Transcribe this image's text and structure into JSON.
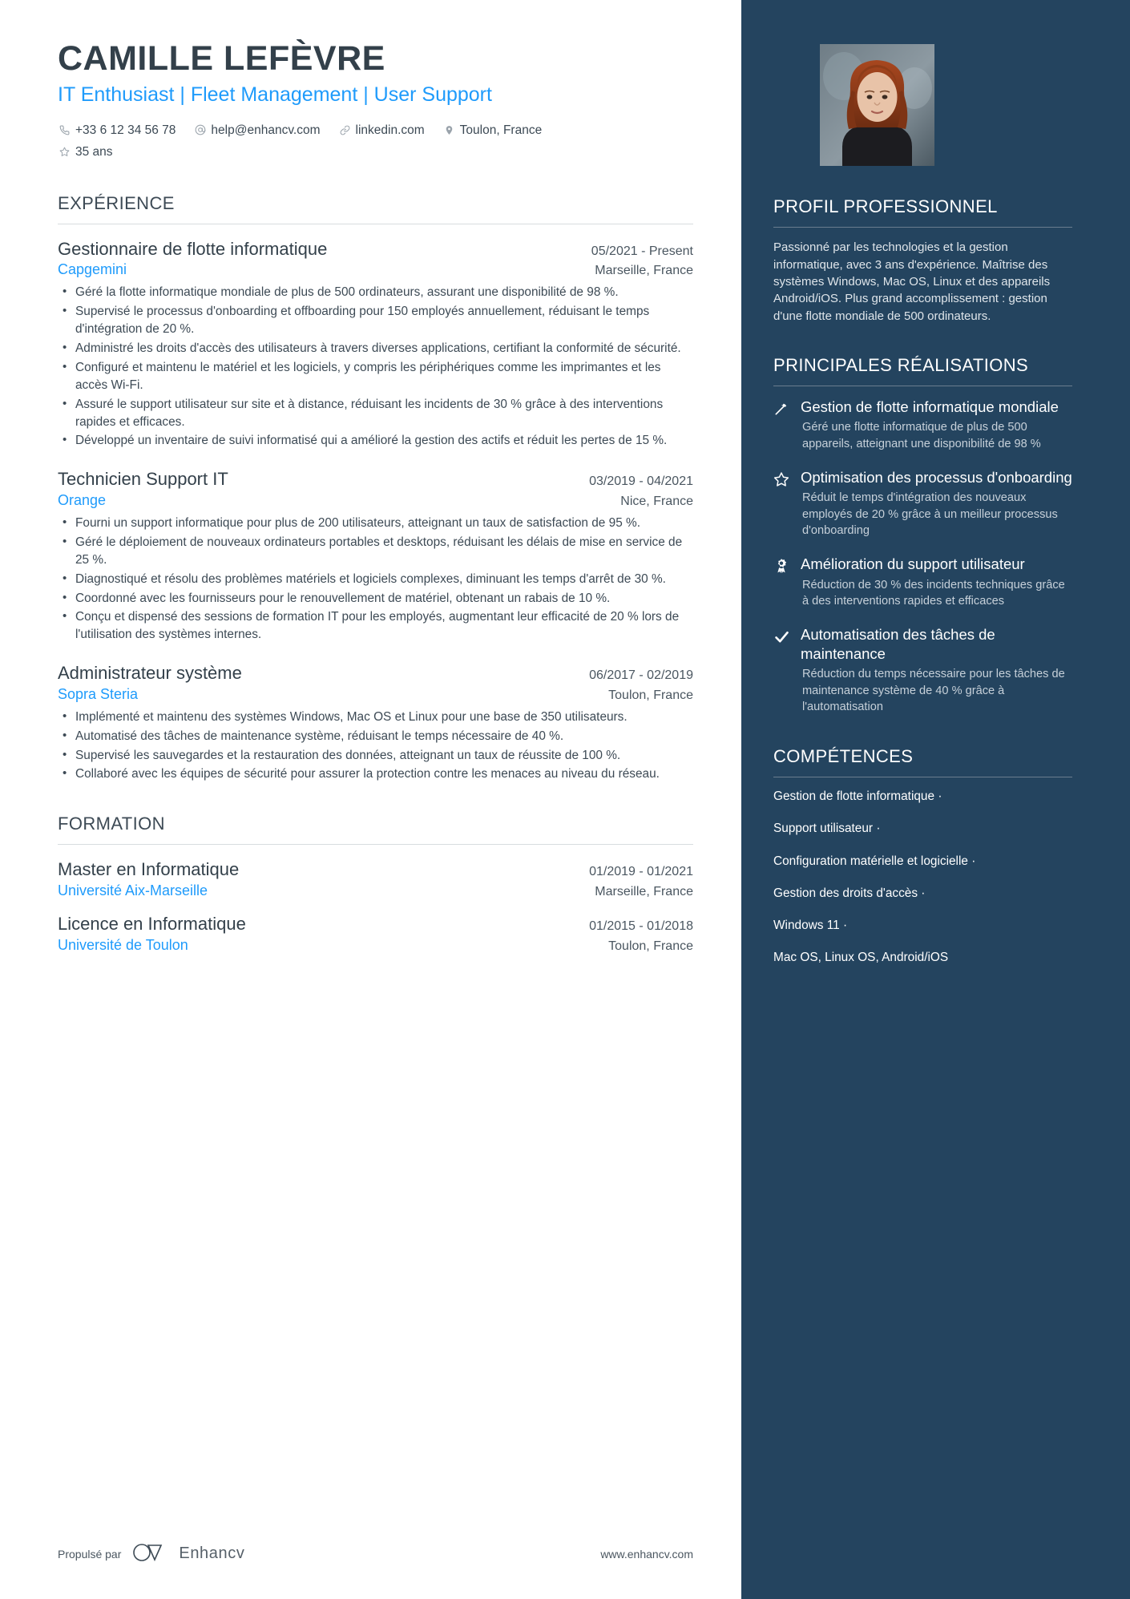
{
  "colors": {
    "accent_blue": "#1f9bfb",
    "sidebar_bg": "#24445f",
    "heading_dark": "#33404a",
    "body_text": "#3d4a55"
  },
  "header": {
    "name": "CAMILLE LEFÈVRE",
    "headline": "IT Enthusiast | Fleet Management | User Support",
    "contacts": [
      {
        "icon": "phone-icon",
        "text": "+33 6 12 34 56 78"
      },
      {
        "icon": "email-icon",
        "text": "help@enhancv.com"
      },
      {
        "icon": "link-icon",
        "text": "linkedin.com"
      },
      {
        "icon": "location-pin-icon",
        "text": "Toulon, France"
      }
    ],
    "contacts_second_row": [
      {
        "icon": "star-icon",
        "text": "35 ans"
      }
    ],
    "photo_alt": "portrait-photo"
  },
  "experience": {
    "title": "EXPÉRIENCE",
    "entries": [
      {
        "role": "Gestionnaire de flotte informatique",
        "date": "05/2021 - Present",
        "company": "Capgemini",
        "location": "Marseille, France",
        "bullets": [
          "Géré la flotte informatique mondiale de plus de 500 ordinateurs, assurant une disponibilité de 98 %.",
          "Supervisé le processus d'onboarding et offboarding pour 150 employés annuellement, réduisant le temps d'intégration de 20 %.",
          "Administré les droits d'accès des utilisateurs à travers diverses applications, certifiant la conformité de sécurité.",
          "Configuré et maintenu le matériel et les logiciels, y compris les périphériques comme les imprimantes et les accès Wi-Fi.",
          "Assuré le support utilisateur sur site et à distance, réduisant les incidents de 30 % grâce à des interventions rapides et efficaces.",
          "Développé un inventaire de suivi informatisé qui a amélioré la gestion des actifs et réduit les pertes de 15 %."
        ]
      },
      {
        "role": "Technicien Support IT",
        "date": "03/2019 - 04/2021",
        "company": "Orange",
        "location": "Nice, France",
        "bullets": [
          "Fourni un support informatique pour plus de 200 utilisateurs, atteignant un taux de satisfaction de 95 %.",
          "Géré le déploiement de nouveaux ordinateurs portables et desktops, réduisant les délais de mise en service de 25 %.",
          "Diagnostiqué et résolu des problèmes matériels et logiciels complexes, diminuant les temps d'arrêt de 30 %.",
          "Coordonné avec les fournisseurs pour le renouvellement de matériel, obtenant un rabais de 10 %.",
          "Conçu et dispensé des sessions de formation IT pour les employés, augmentant leur efficacité de 20 % lors de l'utilisation des systèmes internes."
        ]
      },
      {
        "role": "Administrateur système",
        "date": "06/2017 - 02/2019",
        "company": "Sopra Steria",
        "location": "Toulon, France",
        "bullets": [
          "Implémenté et maintenu des systèmes Windows, Mac OS et Linux pour une base de 350 utilisateurs.",
          "Automatisé des tâches de maintenance système, réduisant le temps nécessaire de 40 %.",
          "Supervisé les sauvegardes et la restauration des données, atteignant un taux de réussite de 100 %.",
          "Collaboré avec les équipes de sécurité pour assurer la protection contre les menaces au niveau du réseau."
        ]
      }
    ]
  },
  "education": {
    "title": "FORMATION",
    "entries": [
      {
        "degree": "Master en Informatique",
        "date": "01/2019 - 01/2021",
        "school": "Université Aix-Marseille",
        "location": "Marseille, France"
      },
      {
        "degree": "Licence en Informatique",
        "date": "01/2015 - 01/2018",
        "school": "Université de Toulon",
        "location": "Toulon, France"
      }
    ]
  },
  "sidebar": {
    "profile": {
      "title": "PROFIL PROFESSIONNEL",
      "text": "Passionné par les technologies et la gestion informatique, avec 3 ans d'expérience. Maîtrise des systèmes Windows, Mac OS, Linux et des appareils Android/iOS. Plus grand accomplissement : gestion d'une flotte mondiale de 500 ordinateurs."
    },
    "achievements": {
      "title": "PRINCIPALES RÉALISATIONS",
      "items": [
        {
          "icon": "magic-wand-icon",
          "title": "Gestion de flotte informatique mondiale",
          "desc": "Géré une flotte informatique de plus de 500 appareils, atteignant une disponibilité de 98 %"
        },
        {
          "icon": "star-outline-icon",
          "title": "Optimisation des processus d'onboarding",
          "desc": "Réduit le temps d'intégration des nouveaux employés de 20 % grâce à un meilleur processus d'onboarding"
        },
        {
          "icon": "award-medal-icon",
          "title": "Amélioration du support utilisateur",
          "desc": "Réduction de 30 % des incidents techniques grâce à des interventions rapides et efficaces"
        },
        {
          "icon": "check-icon",
          "title": "Automatisation des tâches de maintenance",
          "desc": "Réduction du temps nécessaire pour les tâches de maintenance système de 40 % grâce à l'automatisation"
        }
      ]
    },
    "skills": {
      "title": "COMPÉTENCES",
      "items": [
        "Gestion de flotte informatique ·",
        "Support utilisateur ·",
        "Configuration matérielle et logicielle ·",
        "Gestion des droits d'accès ·",
        "Windows 11 ·",
        "Mac OS, Linux OS, Android/iOS"
      ]
    }
  },
  "footer": {
    "powered_by": "Propulsé par",
    "brand": "Enhancv",
    "website": "www.enhancv.com"
  }
}
